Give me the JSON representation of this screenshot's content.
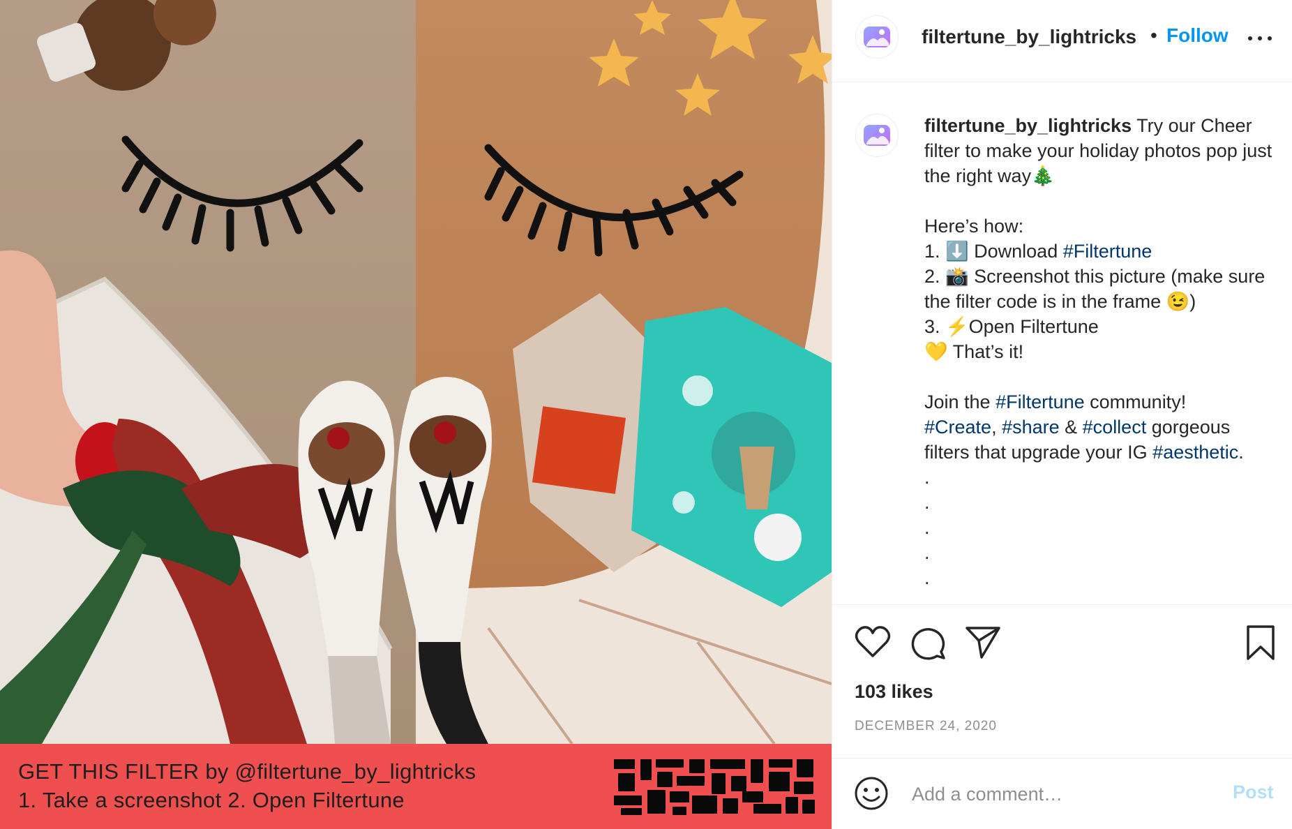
{
  "header": {
    "username": "filtertune_by_lightricks",
    "separator": "•",
    "follow_label": "Follow"
  },
  "media": {
    "banner_line_1": "GET THIS FILTER by @filtertune_by_lightricks",
    "banner_line_2": "1. Take a screenshot 2. Open Filtertune"
  },
  "caption": {
    "username": "filtertune_by_lightricks",
    "intro": "Try our Cheer filter to make your holiday photos pop just the right way🎄",
    "heres_how": "Here’s how:",
    "step1_prefix": "1. ⬇️ Download ",
    "step1_tag": "#Filtertune",
    "step2": "2. 📸 Screenshot this picture (make sure the filter code is in the frame 😉)",
    "step3": "3. ⚡Open Filtertune",
    "step4": "💛 That’s it!",
    "join_prefix": "Join the ",
    "join_tag": "#Filtertune",
    "join_suffix": " community!",
    "tag_create": "#Create",
    "comma": ", ",
    "tag_share": "#share",
    "amp": " & ",
    "tag_collect": "#collect",
    "gorgeous": " gorgeous filters that upgrade your IG ",
    "tag_aesthetic": "#aesthetic",
    "period": ".",
    "dots": [
      ".",
      ".",
      ".",
      ".",
      "."
    ]
  },
  "actions": {
    "likes": "103 likes",
    "date": "DECEMBER 24, 2020"
  },
  "comment": {
    "placeholder": "Add a comment…",
    "post_label": "Post"
  },
  "colors": {
    "follow": "#0095f6",
    "hashtag": "#00376b",
    "banner": "#ef4f4f",
    "post_disabled": "#b2dffc"
  },
  "icons": [
    "filtertune-logo-icon",
    "more-options-icon",
    "heart-icon",
    "comment-icon",
    "share-icon",
    "bookmark-icon",
    "emoji-icon"
  ]
}
